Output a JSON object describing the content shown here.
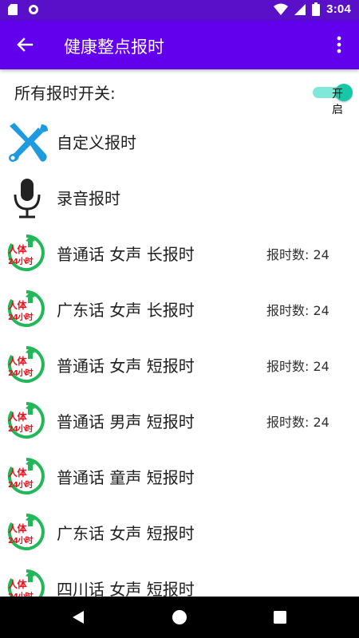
{
  "status_bar": {
    "time": "3:04"
  },
  "app_bar": {
    "title": "健康整点报时"
  },
  "master_switch": {
    "label": "所有报时开关:",
    "state_text": "开启",
    "checked": true
  },
  "items": [
    {
      "label": "自定义报时",
      "icon": "tools-icon",
      "count": ""
    },
    {
      "label": "录音报时",
      "icon": "microphone-icon",
      "count": ""
    },
    {
      "label": "普通话 女声 长报时",
      "icon": "body-clock-icon",
      "count": "报时数: 24"
    },
    {
      "label": "广东话 女声 长报时",
      "icon": "body-clock-icon",
      "count": "报时数: 24"
    },
    {
      "label": "普通话 女声 短报时",
      "icon": "body-clock-icon",
      "count": "报时数: 24"
    },
    {
      "label": "普通话 男声 短报时",
      "icon": "body-clock-icon",
      "count": "报时数: 24"
    },
    {
      "label": "普通话 童声 短报时",
      "icon": "body-clock-icon",
      "count": ""
    },
    {
      "label": "广东话 女声 短报时",
      "icon": "body-clock-icon",
      "count": ""
    },
    {
      "label": "四川话 女声 短报时",
      "icon": "body-clock-icon",
      "count": ""
    }
  ],
  "badge_text": {
    "line1": "人体",
    "line2": "24小时"
  },
  "colors": {
    "status_bar": "#5a0fc8",
    "app_bar": "#6200ee",
    "switch_track": "#7fe8d8",
    "switch_thumb": "#18c7a8",
    "tools_icon": "#1e9be0",
    "badge_ring": "#22b85a",
    "badge_text": "#e8101c"
  }
}
